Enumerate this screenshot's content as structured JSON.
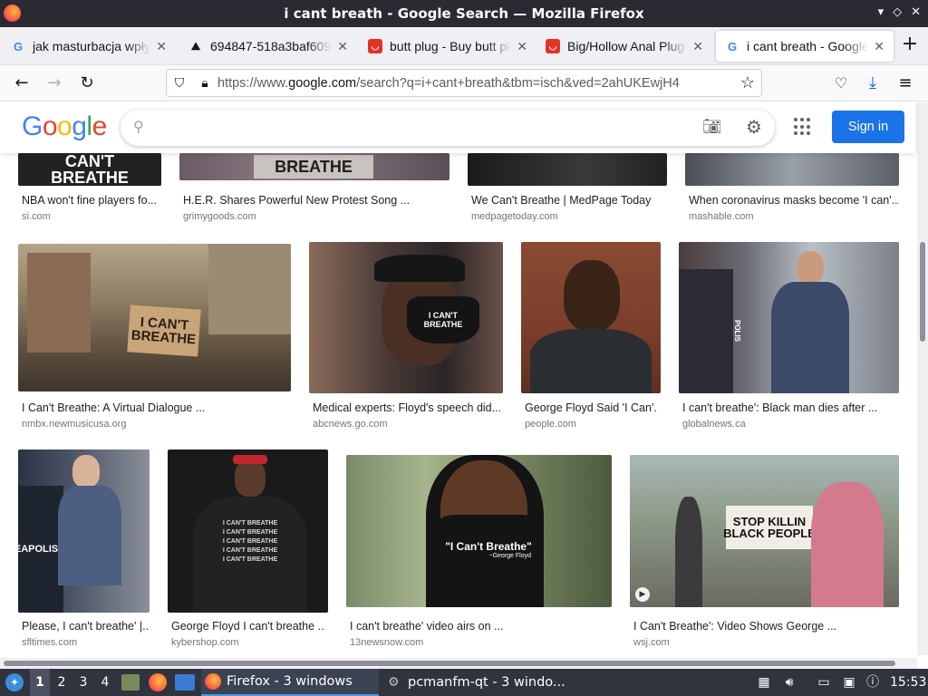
{
  "window": {
    "title": "i cant breath - Google Search — Mozilla Firefox",
    "controls": [
      "▾",
      "◇",
      "✕"
    ]
  },
  "tabs": [
    {
      "label": "jak masturbacja wpływa",
      "favicon": "google-g",
      "active": false
    },
    {
      "label": "694847-518a3baf609",
      "favicon": "person-silhouette",
      "active": false
    },
    {
      "label": "butt plug - Buy butt plug",
      "favicon": "aliexpress-bag",
      "active": false
    },
    {
      "label": "Big/Hollow Anal Plug",
      "favicon": "aliexpress-bag",
      "active": false
    },
    {
      "label": "i cant breath - Google Search",
      "favicon": "google-g",
      "active": true
    }
  ],
  "navbar": {
    "url_prefix": "https://www.",
    "url_domain": "google.com",
    "url_rest": "/search?q=i+cant+breath&tbm=isch&ved=2ahUKEwjH4"
  },
  "google": {
    "logo": [
      "G",
      "o",
      "o",
      "g",
      "l",
      "e"
    ],
    "logo_colors": [
      "#4285f4",
      "#ea4335",
      "#fbbc05",
      "#4285f4",
      "#34a853",
      "#ea4335"
    ],
    "search_value": "",
    "signin_label": "Sign in"
  },
  "results": [
    {
      "caption": "NBA won't fine players fo...",
      "domain": "si.com",
      "sign": "CAN'T\nBREATHE"
    },
    {
      "caption": "H.E.R. Shares Powerful New Protest Song ...",
      "domain": "grimygoods.com",
      "sign": "BREATHE"
    },
    {
      "caption": "We Can't Breathe | MedPage Today",
      "domain": "medpagetoday.com"
    },
    {
      "caption": "When coronavirus masks become 'I can'...",
      "domain": "mashable.com"
    },
    {
      "caption": "I Can't Breathe: A Virtual Dialogue ...",
      "domain": "nmbx.newmusicusa.org",
      "sign": "I CAN'T\nBREATHE"
    },
    {
      "caption": "Medical experts: Floyd's speech did...",
      "domain": "abcnews.go.com",
      "sign": "I CAN'T\nBREATHE"
    },
    {
      "caption": "George Floyd Said 'I Can'...",
      "domain": "people.com"
    },
    {
      "caption": "I can't breathe': Black man dies after ...",
      "domain": "globalnews.ca",
      "sign": "POLIS"
    },
    {
      "caption": "Please, I can't breathe' |...",
      "domain": "sfltimes.com",
      "sign": "EAPOLIS"
    },
    {
      "caption": "George Floyd I can't breathe ...",
      "domain": "kybershop.com",
      "sign": "I CAN'T BREATHE\nI CAN'T BREATHE\nI CAN'T BREATHE\nI CAN'T BREATHE\nI CAN'T BREATHE"
    },
    {
      "caption": "I can't breathe' video airs on ...",
      "domain": "13newsnow.com",
      "sign": "\"I Can't Breathe\"",
      "sign2": "~George Floyd"
    },
    {
      "caption": "I Can't Breathe': Video Shows George ...",
      "domain": "wsj.com",
      "sign": "STOP KILLIN\nBLACK PEOPLE"
    }
  ],
  "taskbar": {
    "workspaces": [
      "1",
      "2",
      "3",
      "4"
    ],
    "windows": [
      {
        "label": "Firefox - 3 windows",
        "active": true
      },
      {
        "label": "pcmanfm-qt - 3 windo...",
        "active": false
      }
    ],
    "clock": "15:53"
  }
}
